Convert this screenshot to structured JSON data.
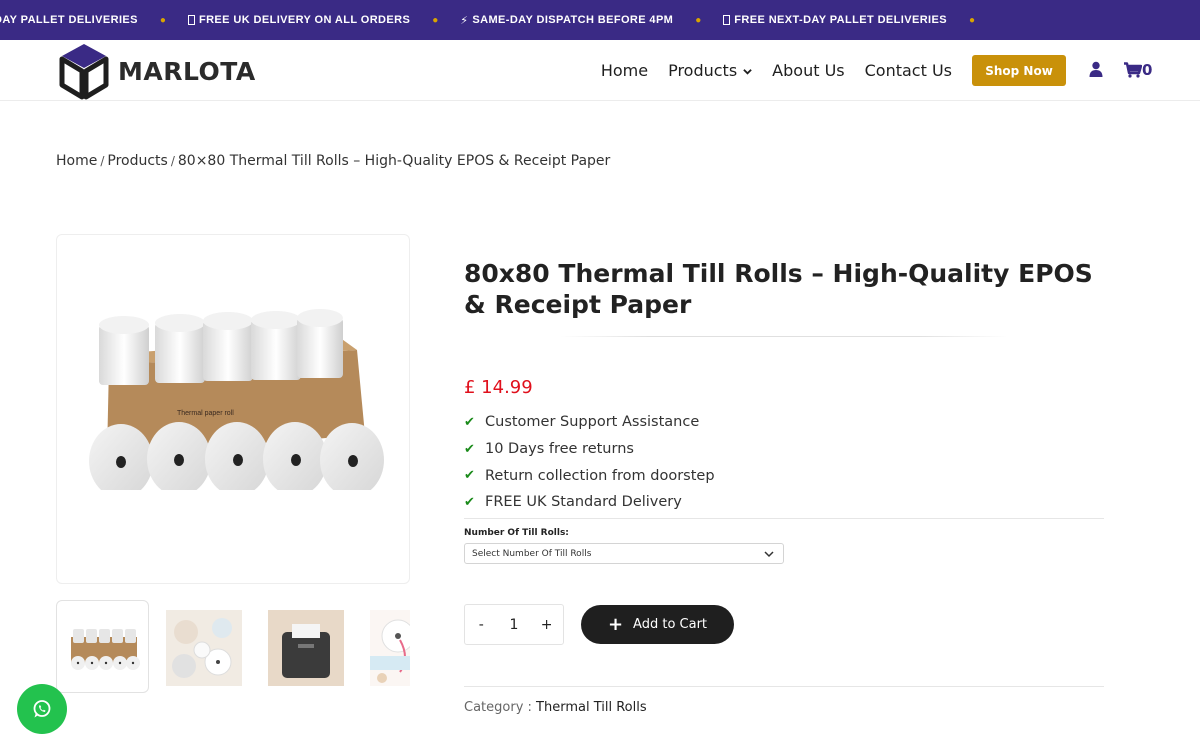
{
  "announcements": [
    {
      "icon": "none",
      "text": "DAY PALLET DELIVERIES"
    },
    {
      "icon": "box-glyph-icon",
      "text": "FREE UK DELIVERY ON ALL ORDERS"
    },
    {
      "icon": "lightning-icon",
      "text": "SAME-DAY DISPATCH BEFORE 4PM"
    },
    {
      "icon": "box-glyph-icon",
      "text": "FREE NEXT-DAY PALLET DELIVERIES"
    }
  ],
  "brand": {
    "name": "MARLOTA",
    "accent": "#3a2a85",
    "cta": "#c9910a"
  },
  "nav": {
    "home": "Home",
    "products": "Products",
    "about": "About Us",
    "contact": "Contact Us",
    "shop_now": "Shop Now",
    "cart_count": "0"
  },
  "breadcrumb": {
    "home": "Home",
    "products": "Products",
    "current": "80×80 Thermal Till Rolls – High-Quality EPOS & Receipt Paper"
  },
  "product": {
    "title": "80x80 Thermal Till Rolls – High-Quality EPOS & Receipt Paper",
    "price": "£ 14.99",
    "features": [
      "Customer Support Assistance",
      "10 Days free returns",
      "Return collection from doorstep",
      "FREE UK Standard Delivery"
    ],
    "variation_label": "Number Of Till Rolls:",
    "variation_placeholder": "Select Number Of Till Rolls",
    "quantity": "1",
    "qty_minus": "-",
    "qty_plus": "+",
    "add_to_cart": "Add to Cart",
    "category_label": "Category :",
    "category_value": "Thermal Till Rolls",
    "box_print": "Thermal paper roll"
  }
}
